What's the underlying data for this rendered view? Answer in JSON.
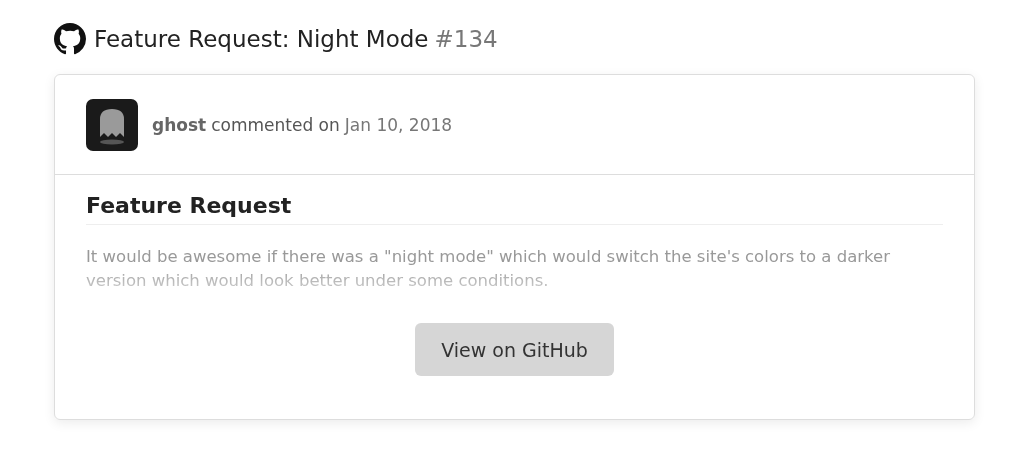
{
  "issue": {
    "title": "Feature Request: Night Mode",
    "number": "#134"
  },
  "comment": {
    "author": "ghost",
    "action": "commented on",
    "date": "Jan 10, 2018"
  },
  "body": {
    "heading": "Feature Request",
    "text": "It would be awesome if there was a \"night mode\" which would switch the site's colors to a darker version which would look better under some conditions."
  },
  "button": {
    "label": "View on GitHub"
  }
}
